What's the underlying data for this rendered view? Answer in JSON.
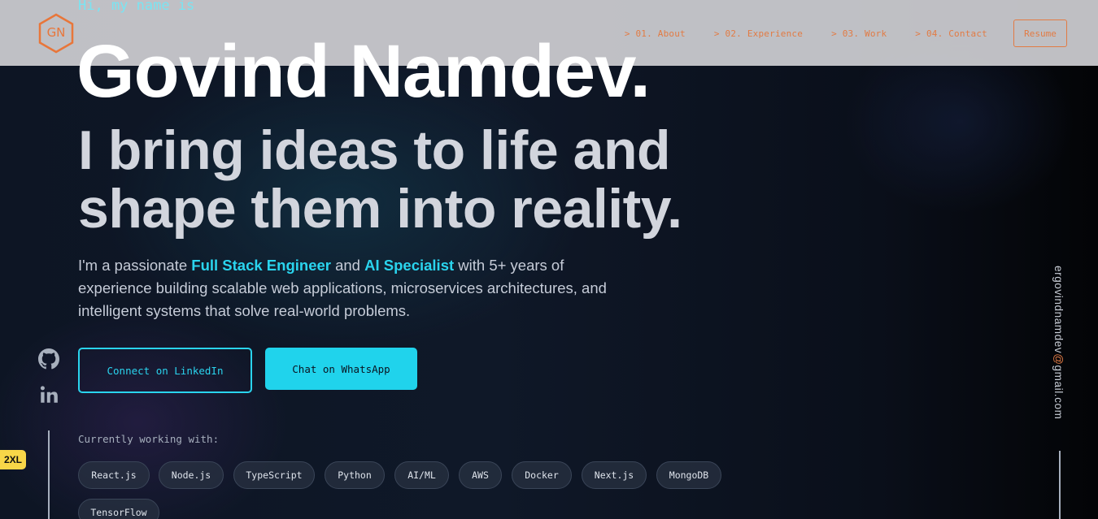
{
  "header": {
    "logo_text": "GN",
    "nav": [
      {
        "label": "> 01. About"
      },
      {
        "label": "> 02. Experience"
      },
      {
        "label": "> 03. Work"
      },
      {
        "label": "> 04. Contact"
      }
    ],
    "resume_label": "Resume"
  },
  "hero": {
    "greeting": "Hi, my name is",
    "name": "Govind Namdev.",
    "tagline_line1": "I bring ideas to life and",
    "tagline_line2": "shape them into reality.",
    "intro": {
      "prefix": "I'm a passionate ",
      "highlight1": "Full Stack Engineer",
      "mid": " and ",
      "highlight2": "AI Specialist",
      "suffix": " with 5+ years of experience building scalable web applications, microservices architectures, and intelligent systems that solve real-world problems."
    },
    "linkedin_button": "Connect on LinkedIn",
    "whatsapp_button": "Chat on WhatsApp",
    "working_label": "Currently working with:",
    "tech": [
      "React.js",
      "Node.js",
      "TypeScript",
      "Python",
      "AI/ML",
      "AWS",
      "Docker",
      "Next.js",
      "MongoDB",
      "TensorFlow"
    ]
  },
  "social": {
    "icons": [
      "github-icon",
      "linkedin-icon"
    ],
    "breakpoint_badge": "2XL"
  },
  "email": {
    "user": "ergovindnamdev",
    "at": "@",
    "domain": "gmail.com"
  },
  "colors": {
    "accent": "#2ad4ee",
    "nav_orange": "#e27b44",
    "background": "#0f1828",
    "badge": "#f8d648"
  }
}
